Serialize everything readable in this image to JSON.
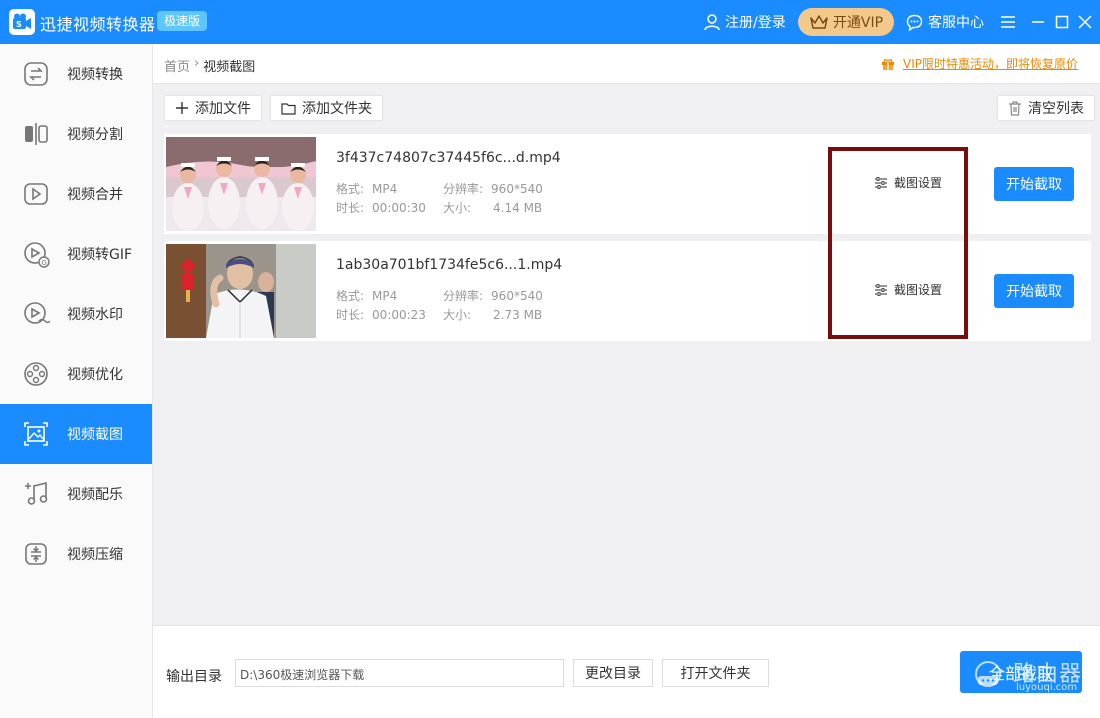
{
  "app": {
    "title": "迅捷视频转换器",
    "badge": "极速版"
  },
  "header": {
    "login": "注册/登录",
    "vip": "开通VIP",
    "service": "客服中心"
  },
  "sidebar": {
    "items": [
      {
        "label": "视频转换",
        "icon": "convert-icon"
      },
      {
        "label": "视频分割",
        "icon": "split-icon"
      },
      {
        "label": "视频合并",
        "icon": "merge-icon"
      },
      {
        "label": "视频转GIF",
        "icon": "gif-icon"
      },
      {
        "label": "视频水印",
        "icon": "watermark-icon"
      },
      {
        "label": "视频优化",
        "icon": "film-reel-icon"
      },
      {
        "label": "视频截图",
        "icon": "image-icon",
        "active": true
      },
      {
        "label": "视频配乐",
        "icon": "music-icon"
      },
      {
        "label": "视频压缩",
        "icon": "compress-icon"
      }
    ]
  },
  "breadcrumb": {
    "home": "首页",
    "sep": "›",
    "current": "视频截图"
  },
  "promo": {
    "text": "VIP限时特惠活动，即将恢复原价"
  },
  "toolbar": {
    "add_file": "添加文件",
    "add_folder": "添加文件夹",
    "clear_list": "清空列表"
  },
  "labels": {
    "format": "格式:",
    "resolution": "分辨率:",
    "duration": "时长:",
    "size": "大小:",
    "settings": "截图设置",
    "start": "开始截取"
  },
  "files": [
    {
      "name": "3f437c74807c37445f6c...d.mp4",
      "format": "MP4",
      "resolution": "960*540",
      "duration": "00:00:30",
      "size": "4.14 MB"
    },
    {
      "name": "1ab30a701bf1734fe5c6...1.mp4",
      "format": "MP4",
      "resolution": "960*540",
      "duration": "00:00:23",
      "size": "2.73 MB"
    }
  ],
  "bottom": {
    "output_label": "输出目录",
    "output_path": "D:\\360极速浏览器下载",
    "change_dir": "更改目录",
    "open_folder": "打开文件夹",
    "all_capture": "全部截取"
  },
  "watermark": {
    "text": "路由器",
    "url": "luyouqi.com"
  },
  "colors": {
    "primary": "#1a8cff",
    "vip_bg": "#f3c98b",
    "promo": "#e88a00",
    "highlight": "#7a0c0c"
  }
}
